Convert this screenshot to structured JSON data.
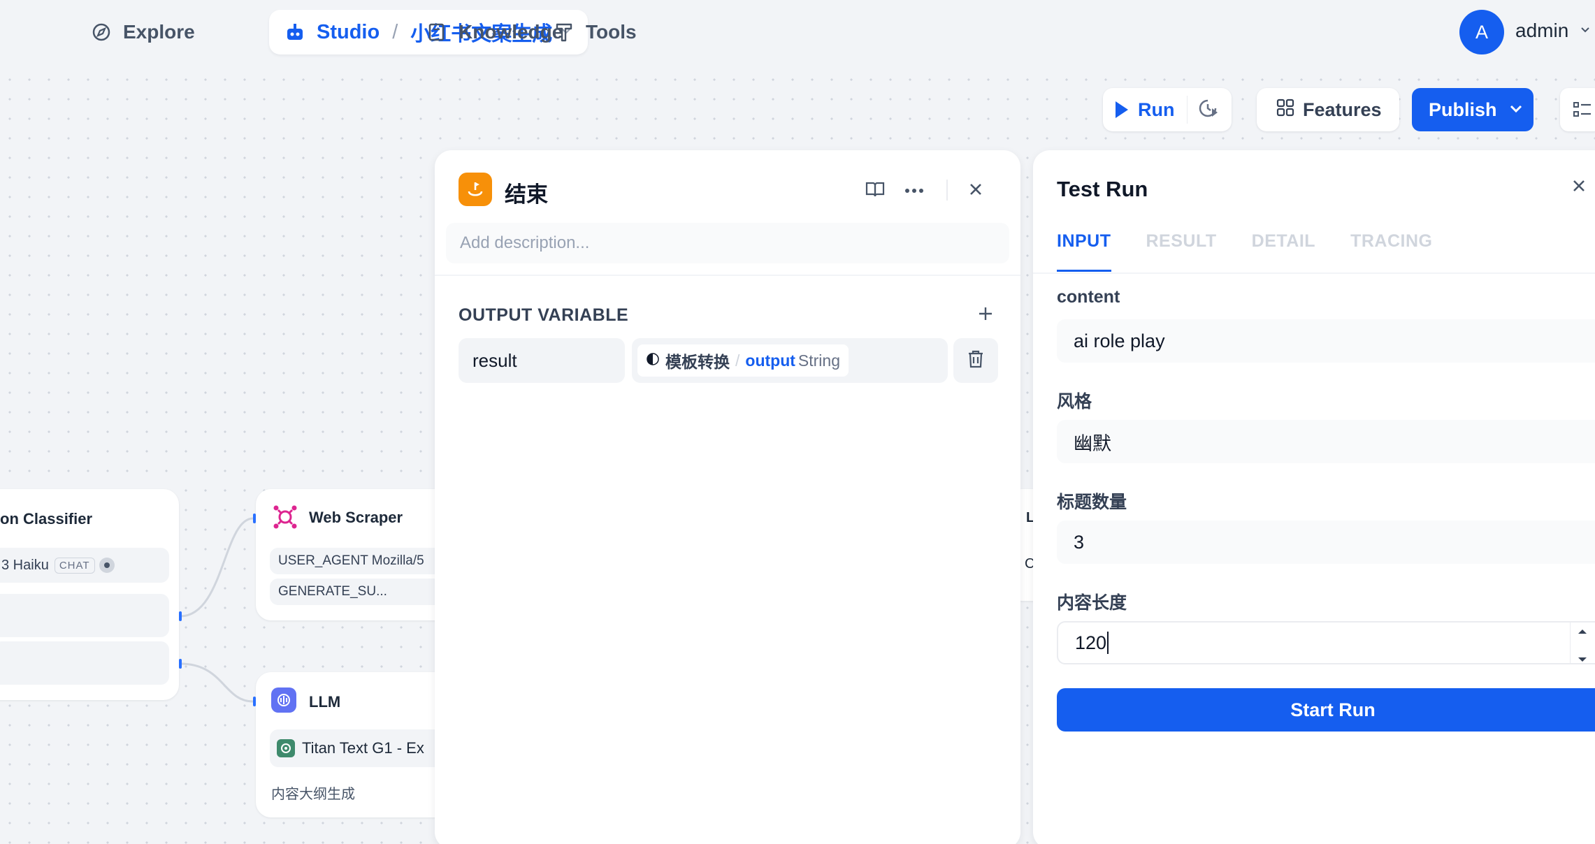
{
  "nav": {
    "explore": "Explore",
    "studio": "Studio",
    "app_name": "小红书文案生成",
    "knowledge": "Knowledge",
    "tools": "Tools",
    "avatar_letter": "A",
    "user": "admin"
  },
  "toolbar": {
    "run": "Run",
    "features": "Features",
    "publish": "Publish"
  },
  "nodes": {
    "classifier": {
      "title": "on Classifier",
      "model": "3 Haiku",
      "model_badge": "CHAT"
    },
    "web_scraper": {
      "title": "Web Scraper",
      "rows": [
        "USER_AGENT Mozilla/5",
        "GENERATE_SU..."
      ]
    },
    "llm": {
      "title": "LLM",
      "model": "Titan Text G1 - Ex",
      "description": "内容大纲生成"
    },
    "right_partial": {
      "letter1": "L",
      "letter2": "C"
    }
  },
  "end_panel": {
    "title": "结束",
    "description_placeholder": "Add description...",
    "section_label": "OUTPUT VARIABLE",
    "variables": [
      {
        "name": "result",
        "source_node": "模板转换",
        "source_var": "output",
        "source_type": "String"
      }
    ]
  },
  "test_run": {
    "title": "Test Run",
    "tabs": [
      "INPUT",
      "RESULT",
      "DETAIL",
      "TRACING"
    ],
    "active_tab": "INPUT",
    "fields": [
      {
        "label": "content",
        "value": "ai role play"
      },
      {
        "label": "风格",
        "value": "幽默"
      },
      {
        "label": "标题数量",
        "value": "3"
      },
      {
        "label": "内容长度",
        "value": "120"
      }
    ],
    "start_button": "Start Run"
  },
  "colors": {
    "primary": "#155eef",
    "end_node": "#f79009",
    "llm_node": "#6172f3",
    "scraper_node": "#dd2590"
  }
}
